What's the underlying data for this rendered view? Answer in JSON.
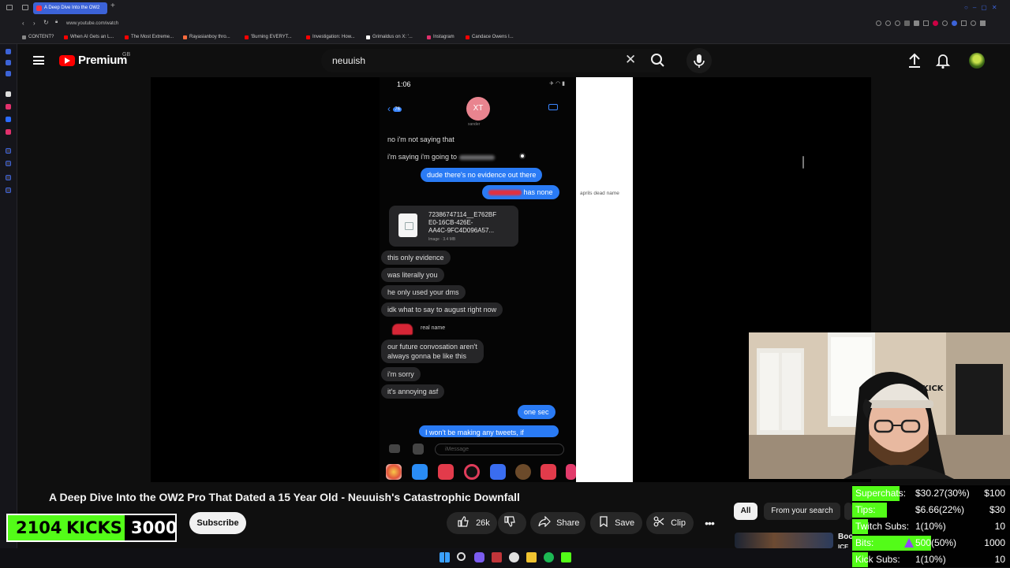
{
  "browser": {
    "active_tab_title": "A Deep Dive Into the OW2",
    "url": "www.youtube.com/watch",
    "bookmarks": [
      {
        "label": "CONTENT?",
        "color": "#888888"
      },
      {
        "label": "When AI Gets an L...",
        "color": "#ff0000"
      },
      {
        "label": "The Most Extreme...",
        "color": "#ff0000"
      },
      {
        "label": "Rayasianboy thro...",
        "color": "#ff6b3d"
      },
      {
        "label": "'Burning EVERYT...",
        "color": "#ff0000"
      },
      {
        "label": "Investigation: How...",
        "color": "#ff0000"
      },
      {
        "label": "Grimaldus on X: '...",
        "color": "#ffffff"
      },
      {
        "label": "Instagram",
        "color": "#e1306c"
      },
      {
        "label": "Candace Owens I...",
        "color": "#ff0000"
      }
    ]
  },
  "youtube": {
    "brand": "Premium",
    "region": "GB",
    "search_query": "neuuish",
    "video_title": "A Deep Dive Into the OW2 Pro That Dated a 15 Year Old - Neuuish's Catastrophic Downfall",
    "actions": {
      "subscribe": "Subscribe",
      "likes": "26k",
      "share": "Share",
      "save": "Save",
      "clip": "Clip"
    },
    "chips": [
      "All",
      "From your search"
    ],
    "partial_thumb_text": "Boo",
    "partial_thumb_text2": "ICE"
  },
  "phone": {
    "time": "1:06",
    "contact_initials": "XT",
    "contact_name": "xander",
    "back_count": "76",
    "side_annotation": "aprils dead name",
    "messages": [
      {
        "dir": "in",
        "text": "no i'm not saying that"
      },
      {
        "dir": "in",
        "text": "i'm saying i'm going to"
      },
      {
        "dir": "out",
        "text": "dude there's no evidence out there"
      },
      {
        "dir": "out",
        "text": "has none"
      },
      {
        "dir": "in",
        "text": "this only evidence"
      },
      {
        "dir": "in",
        "text": "was literally you"
      },
      {
        "dir": "in",
        "text": "he only used your dms"
      },
      {
        "dir": "in",
        "text": "idk what to say to august right now"
      },
      {
        "dir": "in",
        "text": "our future convosation aren't\nalways gonna be like this"
      },
      {
        "dir": "in",
        "text": "i'm sorry"
      },
      {
        "dir": "in",
        "text": "it's annoying asf"
      },
      {
        "dir": "out",
        "text": "one sec"
      },
      {
        "dir": "out",
        "text": "I won't be making any tweets, if"
      }
    ],
    "file": {
      "name": "72386747114__E762BF\nE0-16CB-426E-\nAA4C-9FC4D096A57...",
      "meta": "Image · 3.4 MB"
    },
    "real_name_label": "real name",
    "composer_placeholder": "iMessage"
  },
  "overlay_kicks": {
    "count": "2104",
    "label": "KICKS",
    "goal": "3000",
    "progress": 0.7
  },
  "overlay_donations": [
    {
      "label": "Superchats:",
      "value": "$30.27(30%)",
      "goal": "$100",
      "progress": 0.3
    },
    {
      "label": "Tips:",
      "value": "$6.66(22%)",
      "goal": "$30",
      "progress": 0.22
    },
    {
      "label": "Twitch Subs:",
      "value": "1(10%)",
      "goal": "10",
      "progress": 0.1
    },
    {
      "label": "Bits:",
      "value": "500(50%)",
      "goal": "1000",
      "progress": 0.5
    },
    {
      "label": "Kick Subs:",
      "value": "1(10%)",
      "goal": "10",
      "progress": 0.1
    }
  ],
  "webcam": {
    "hat_text": "KICK"
  }
}
